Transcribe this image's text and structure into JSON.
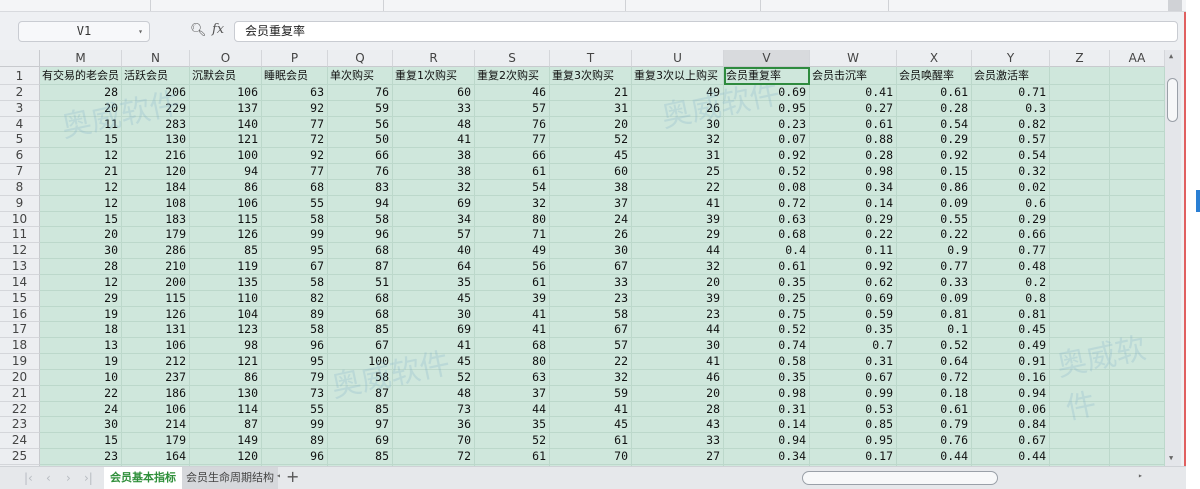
{
  "formula_bar": {
    "name_box": "V1",
    "formula": "会员重复率"
  },
  "icons": {
    "zoom": "magnifier-icon",
    "fx": "fx"
  },
  "columns": [
    "M",
    "N",
    "O",
    "P",
    "Q",
    "R",
    "S",
    "T",
    "U",
    "V",
    "W",
    "X",
    "Y",
    "Z",
    "AA"
  ],
  "headers": [
    "有交易的老会员",
    "活跃会员",
    "沉默会员",
    "睡眠会员",
    "单次购买",
    "重复1次购买",
    "重复2次购买",
    "重复3次购买",
    "重复3次以上购买",
    "会员重复率",
    "会员击沉率",
    "会员唤醒率",
    "会员激活率"
  ],
  "rows": [
    [
      "28",
      "206",
      "106",
      "63",
      "76",
      "60",
      "46",
      "21",
      "49",
      "0.69",
      "0.41",
      "0.61",
      "0.71"
    ],
    [
      "20",
      "229",
      "137",
      "92",
      "59",
      "33",
      "57",
      "31",
      "26",
      "0.95",
      "0.27",
      "0.28",
      "0.3"
    ],
    [
      "11",
      "283",
      "140",
      "77",
      "56",
      "48",
      "76",
      "20",
      "30",
      "0.23",
      "0.61",
      "0.54",
      "0.82"
    ],
    [
      "15",
      "130",
      "121",
      "72",
      "50",
      "41",
      "77",
      "52",
      "32",
      "0.07",
      "0.88",
      "0.29",
      "0.57"
    ],
    [
      "12",
      "216",
      "100",
      "92",
      "66",
      "38",
      "66",
      "45",
      "31",
      "0.92",
      "0.28",
      "0.92",
      "0.54"
    ],
    [
      "21",
      "120",
      "94",
      "77",
      "76",
      "38",
      "61",
      "60",
      "25",
      "0.52",
      "0.98",
      "0.15",
      "0.32"
    ],
    [
      "12",
      "184",
      "86",
      "68",
      "83",
      "32",
      "54",
      "38",
      "22",
      "0.08",
      "0.34",
      "0.86",
      "0.02"
    ],
    [
      "12",
      "108",
      "106",
      "55",
      "94",
      "69",
      "32",
      "37",
      "41",
      "0.72",
      "0.14",
      "0.09",
      "0.6"
    ],
    [
      "15",
      "183",
      "115",
      "58",
      "58",
      "34",
      "80",
      "24",
      "39",
      "0.63",
      "0.29",
      "0.55",
      "0.29"
    ],
    [
      "20",
      "179",
      "126",
      "99",
      "96",
      "57",
      "71",
      "26",
      "29",
      "0.68",
      "0.22",
      "0.22",
      "0.66"
    ],
    [
      "30",
      "286",
      "85",
      "95",
      "68",
      "40",
      "49",
      "30",
      "44",
      "0.4",
      "0.11",
      "0.9",
      "0.77"
    ],
    [
      "28",
      "210",
      "119",
      "67",
      "87",
      "64",
      "56",
      "67",
      "32",
      "0.61",
      "0.92",
      "0.77",
      "0.48"
    ],
    [
      "12",
      "200",
      "135",
      "58",
      "51",
      "35",
      "61",
      "33",
      "20",
      "0.35",
      "0.62",
      "0.33",
      "0.2"
    ],
    [
      "29",
      "115",
      "110",
      "82",
      "68",
      "45",
      "39",
      "23",
      "39",
      "0.25",
      "0.69",
      "0.09",
      "0.8"
    ],
    [
      "19",
      "126",
      "104",
      "89",
      "68",
      "30",
      "41",
      "58",
      "23",
      "0.75",
      "0.59",
      "0.81",
      "0.81"
    ],
    [
      "18",
      "131",
      "123",
      "58",
      "85",
      "69",
      "41",
      "67",
      "44",
      "0.52",
      "0.35",
      "0.1",
      "0.45"
    ],
    [
      "13",
      "106",
      "98",
      "96",
      "67",
      "41",
      "68",
      "57",
      "30",
      "0.74",
      "0.7",
      "0.52",
      "0.49"
    ],
    [
      "19",
      "212",
      "121",
      "95",
      "100",
      "45",
      "80",
      "22",
      "41",
      "0.58",
      "0.31",
      "0.64",
      "0.91"
    ],
    [
      "10",
      "237",
      "86",
      "79",
      "58",
      "52",
      "63",
      "32",
      "46",
      "0.35",
      "0.67",
      "0.72",
      "0.16"
    ],
    [
      "22",
      "186",
      "130",
      "73",
      "87",
      "48",
      "37",
      "59",
      "20",
      "0.98",
      "0.99",
      "0.18",
      "0.94"
    ],
    [
      "24",
      "106",
      "114",
      "55",
      "85",
      "73",
      "44",
      "41",
      "28",
      "0.31",
      "0.53",
      "0.61",
      "0.06"
    ],
    [
      "30",
      "214",
      "87",
      "99",
      "97",
      "36",
      "35",
      "45",
      "43",
      "0.14",
      "0.85",
      "0.79",
      "0.84"
    ],
    [
      "15",
      "179",
      "149",
      "89",
      "69",
      "70",
      "52",
      "61",
      "33",
      "0.94",
      "0.95",
      "0.76",
      "0.67"
    ],
    [
      "23",
      "164",
      "120",
      "96",
      "85",
      "72",
      "61",
      "70",
      "27",
      "0.34",
      "0.17",
      "0.44",
      "0.44"
    ]
  ],
  "sheet_tabs": [
    "会员基本指标",
    "会员生命周期结构"
  ],
  "add_sheet": "+",
  "watermark": "奥威软件 Ourway Power"
}
